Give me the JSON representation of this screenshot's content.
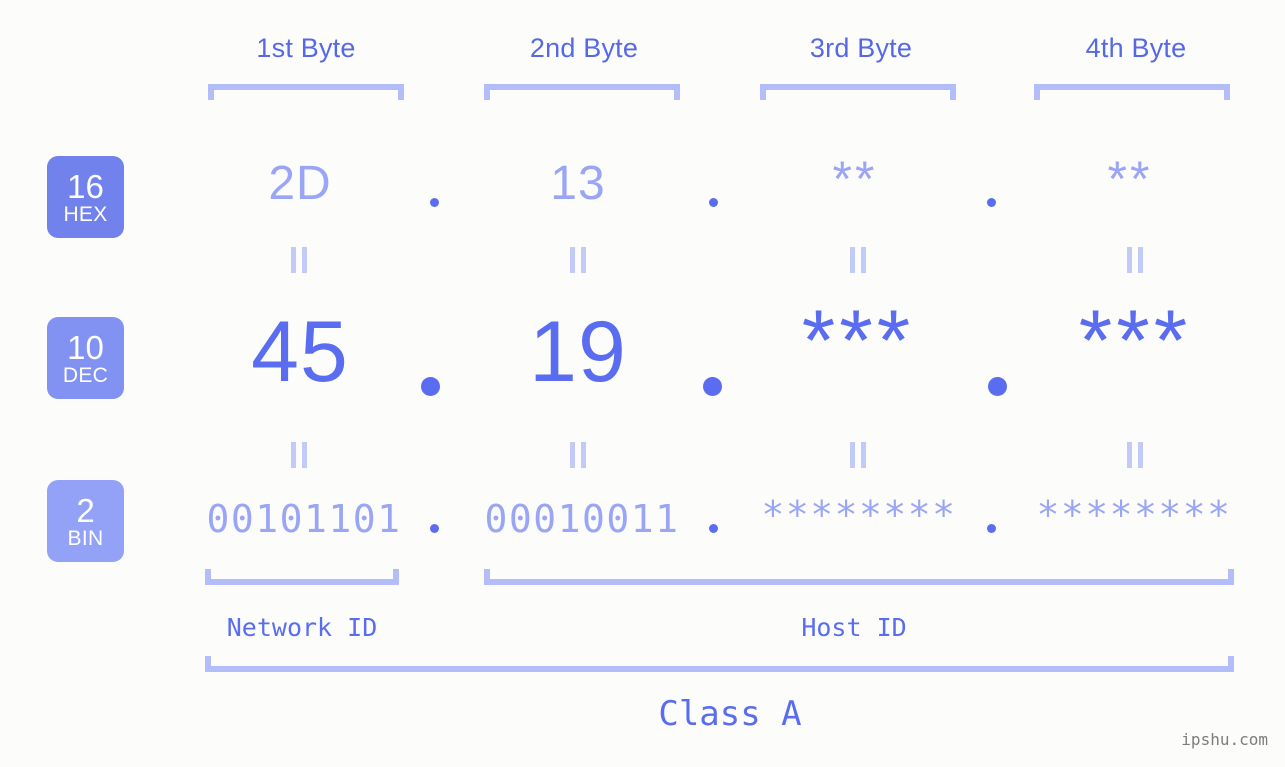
{
  "background_color": "#fcfdfa",
  "accent_colors": {
    "strong_blue": "#5a6df0",
    "header_blue": "#5568e8",
    "light_blue": "#9aa6f5",
    "bracket_blue": "#b3bdfa",
    "equals_blue": "#c2caf8",
    "badge_hex": "#7282ed",
    "badge_dec": "#8292f2",
    "badge_bin": "#93a2f7",
    "watermark_gray": "#7d7d7d"
  },
  "byte_headers": [
    {
      "label": "1st Byte"
    },
    {
      "label": "2nd Byte"
    },
    {
      "label": "3rd Byte"
    },
    {
      "label": "4th Byte"
    }
  ],
  "rows": [
    {
      "badge_number": "16",
      "badge_name": "HEX",
      "values": [
        "2D",
        "13",
        "**",
        "**"
      ],
      "separator": "."
    },
    {
      "badge_number": "10",
      "badge_name": "DEC",
      "values": [
        "45",
        "19",
        "***",
        "***"
      ],
      "separator": "."
    },
    {
      "badge_number": "2",
      "badge_name": "BIN",
      "values": [
        "00101101",
        "00010011",
        "********",
        "********"
      ],
      "separator": "."
    }
  ],
  "equals_marks": {
    "glyph": "=",
    "count_per_gap": 4
  },
  "footer": {
    "network_id_label": "Network ID",
    "host_id_label": "Host ID",
    "class_label": "Class A",
    "watermark": "ipshu.com"
  },
  "ip_address": {
    "hex": "2D.13.**.**",
    "dec": "45.19.***.***",
    "bin": "00101101.00010011.********.********"
  }
}
